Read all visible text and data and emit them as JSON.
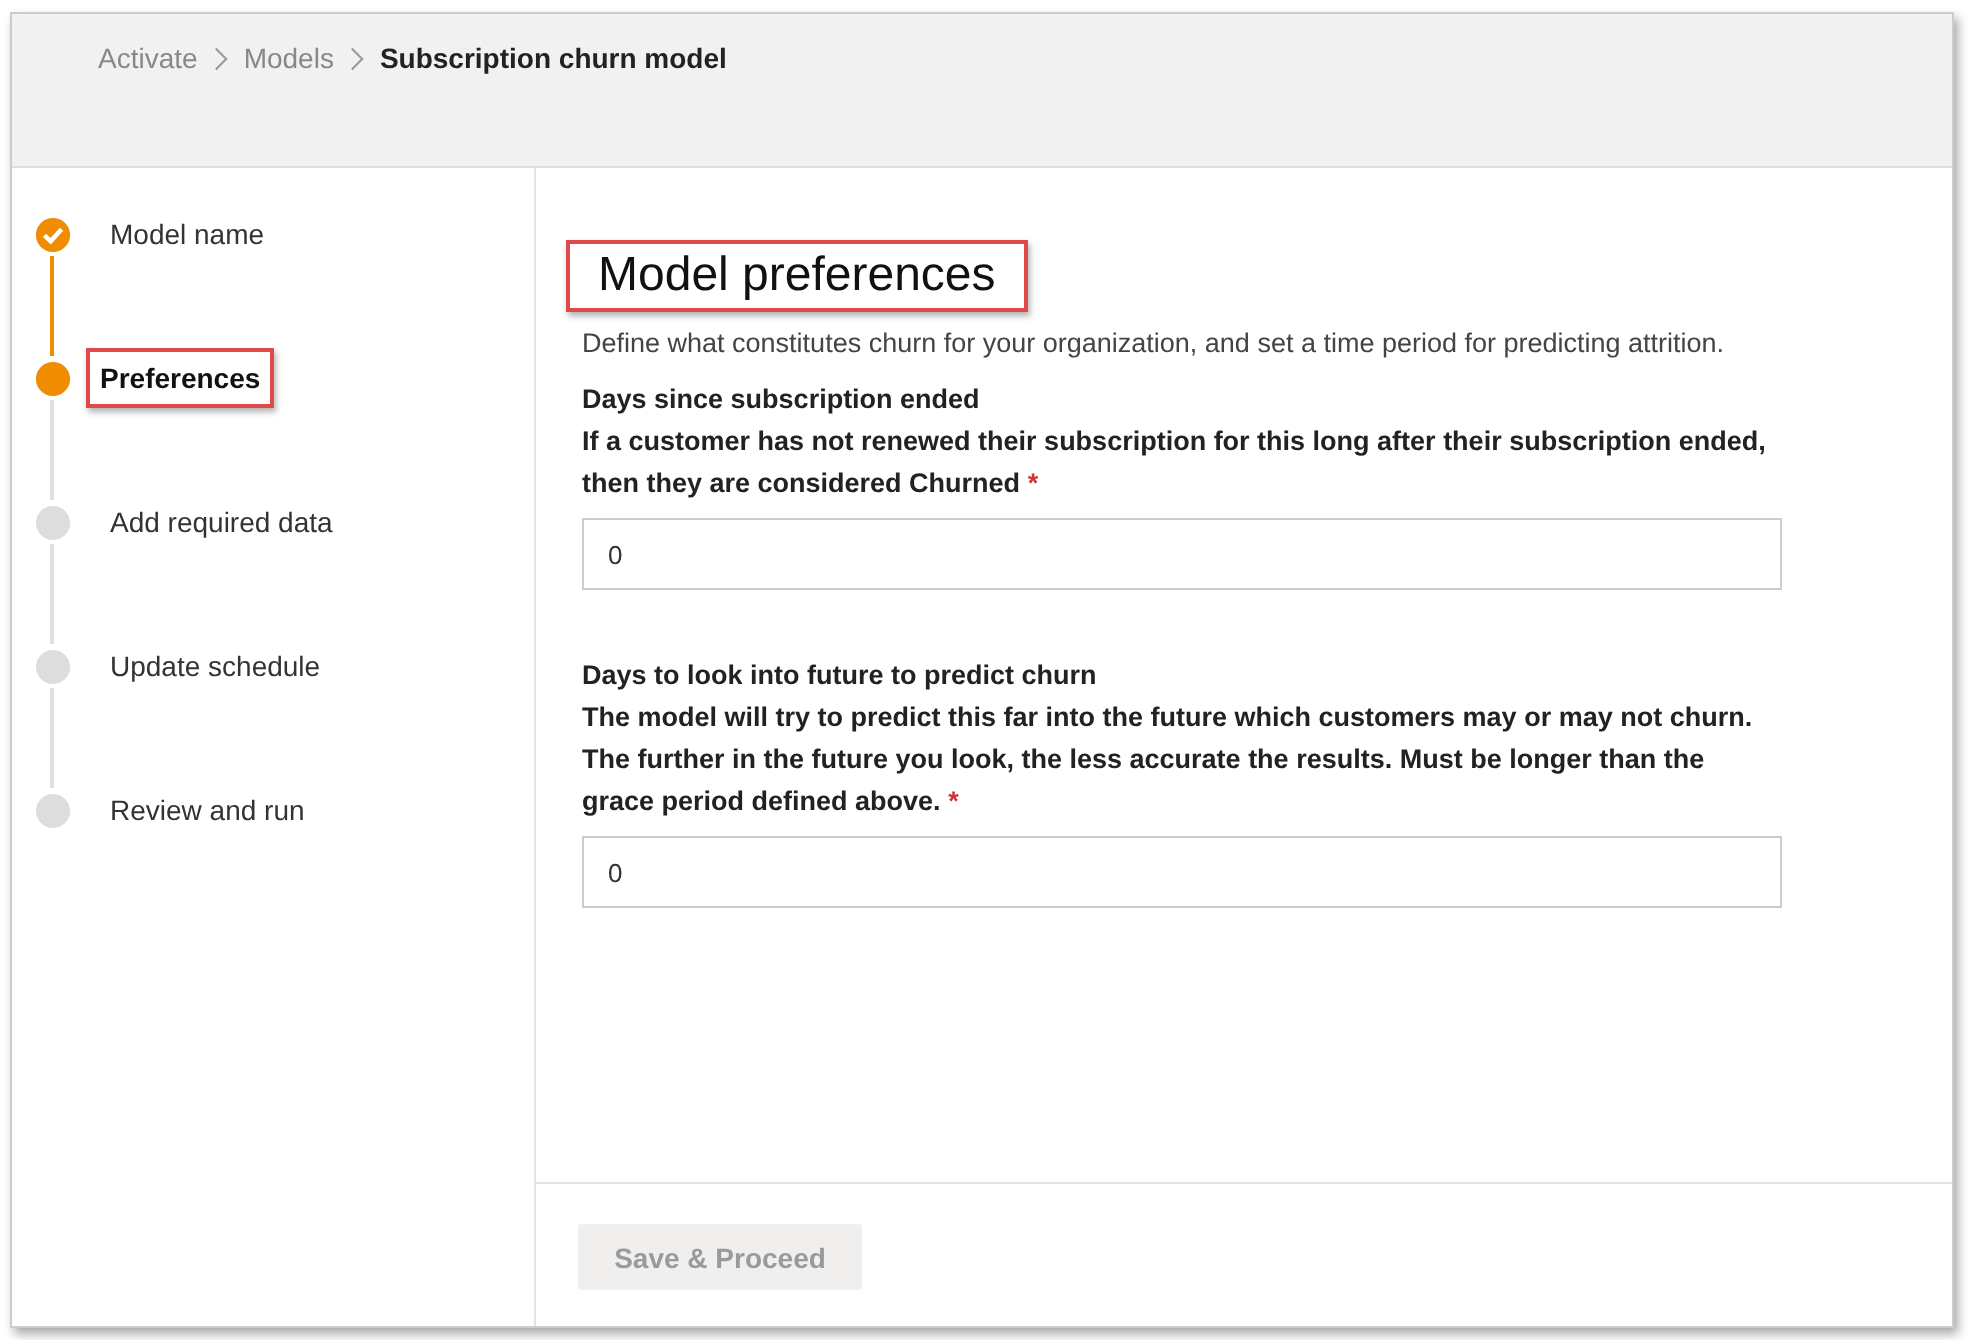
{
  "breadcrumb": [
    {
      "label": "Activate",
      "current": false
    },
    {
      "label": "Models",
      "current": false
    },
    {
      "label": "Subscription churn model",
      "current": true
    }
  ],
  "steps": [
    {
      "label": "Model name",
      "completed": true,
      "selected": false,
      "highlighted": false
    },
    {
      "label": "Preferences",
      "completed": false,
      "selected": true,
      "highlighted": true
    },
    {
      "label": "Add required data",
      "completed": false,
      "selected": false,
      "highlighted": false
    },
    {
      "label": "Update schedule",
      "completed": false,
      "selected": false,
      "highlighted": false
    },
    {
      "label": "Review and run",
      "completed": false,
      "selected": false,
      "highlighted": false
    }
  ],
  "heading": {
    "text": "Model preferences",
    "highlighted": true
  },
  "intro": "Define what constitutes churn for your organization, and set a time period for predicting attrition.",
  "fields": [
    {
      "label": "Days since subscription ended",
      "description": "If a customer has not renewed their subscription for this long after their subscription ended, then they are considered Churned",
      "required": true,
      "value": "0"
    },
    {
      "label": "Days to look into future to predict churn",
      "description": "The model will try to predict this far into the future which customers may or may not churn. The further in the future you look, the less accurate the results. Must be longer than the grace period defined above.",
      "required": true,
      "value": "0"
    }
  ],
  "required_mark": "*",
  "save_button": {
    "label": "Save & Proceed",
    "disabled": true
  }
}
